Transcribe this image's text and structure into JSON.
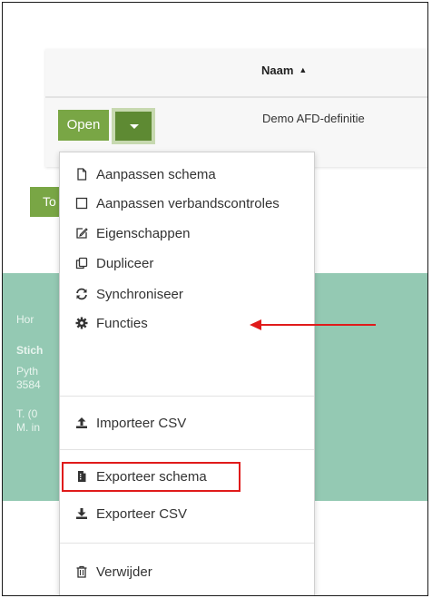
{
  "table": {
    "col_name": "Naam",
    "row_name": "Demo AFD-definitie"
  },
  "buttons": {
    "open_label": "Open",
    "partial_label": "To"
  },
  "menu": {
    "items": [
      {
        "label": "Aanpassen schema",
        "icon": "file-icon"
      },
      {
        "label": "Aanpassen verbandscontroles",
        "icon": "square-icon"
      },
      {
        "label": "Eigenschappen",
        "icon": "edit-icon"
      },
      {
        "label": "Dupliceer",
        "icon": "copy-icon"
      },
      {
        "label": "Synchroniseer",
        "icon": "sync-icon"
      },
      {
        "label": "Functies",
        "icon": "gear-icon"
      },
      {
        "label": "Importeer CSV",
        "icon": "upload-icon"
      },
      {
        "label": "Exporteer schema",
        "icon": "file-export-icon"
      },
      {
        "label": "Exporteer CSV",
        "icon": "download-icon"
      },
      {
        "label": "Verwijder",
        "icon": "trash-icon"
      }
    ]
  },
  "footer": {
    "line1": "Hor",
    "line2": "Stich",
    "line3": "Pyth",
    "line4": "3584",
    "line5": "T. (0",
    "line6": "M. in"
  },
  "colors": {
    "primary": "#79a645",
    "primary_dark": "#5e8a33",
    "footer_bg": "#94c9b3",
    "highlight": "#e01b1b"
  }
}
